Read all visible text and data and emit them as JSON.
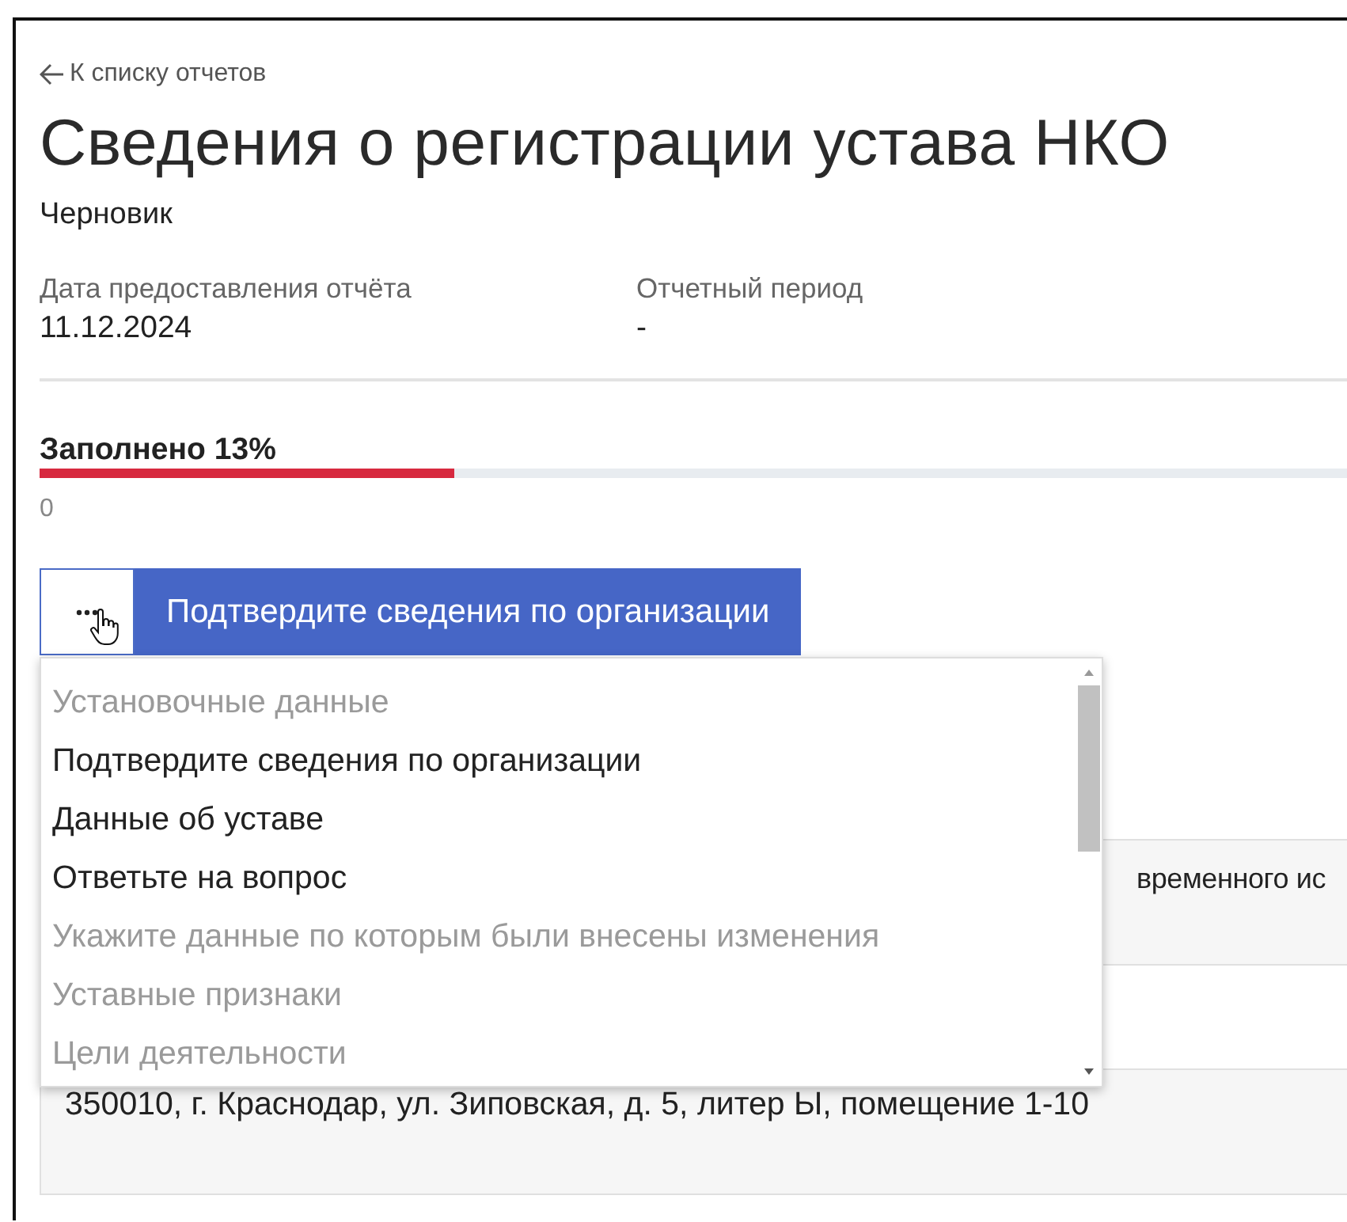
{
  "back_link": "К списку отчетов",
  "title": "Сведения о регистрации устава НКО",
  "status": "Черновик",
  "fields": [
    {
      "label": "Дата предоставления отчёта",
      "value": "11.12.2024"
    },
    {
      "label": "Отчетный период",
      "value": "-"
    }
  ],
  "progress": {
    "label": "Заполнено 13%",
    "level": 0.13,
    "caption": "0"
  },
  "section_button": {
    "label": "Подтвердите сведения по организации"
  },
  "section_menu": {
    "items": [
      {
        "label": "Установочные данные",
        "disabled": true
      },
      {
        "label": "Подтвердите сведения по организации",
        "disabled": false
      },
      {
        "label": "Данные об уставе",
        "disabled": false
      },
      {
        "label": "Ответьте на вопрос",
        "disabled": false
      },
      {
        "label": "Укажите данные по которым были внесены изменения",
        "disabled": true
      },
      {
        "label": "Уставные признаки",
        "disabled": true
      },
      {
        "label": "Цели деятельности",
        "disabled": true
      }
    ]
  },
  "question_box": {
    "text": "временного ис"
  },
  "address_box": {
    "text": "350010, г. Краснодар, ул. Зиповская, д. 5, литер Ы, помещение 1-10"
  }
}
